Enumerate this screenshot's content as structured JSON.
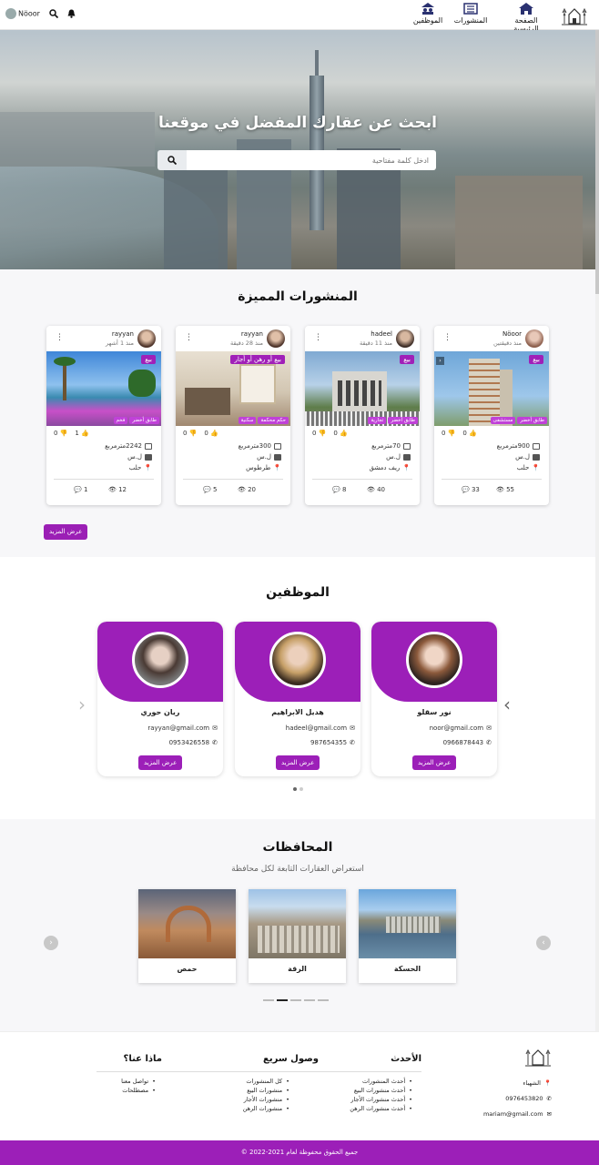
{
  "navbar": {
    "items": [
      {
        "label": "الصفحة الرئيسية",
        "icon": "home-icon"
      },
      {
        "label": "المنشورات",
        "icon": "newspaper-icon"
      },
      {
        "label": "الموظفين",
        "icon": "users-icon"
      }
    ],
    "username": "Nöoor",
    "icons": [
      "bell-icon",
      "search-icon"
    ]
  },
  "hero": {
    "title": "ابحث عن عقارك المفضل في موقعنا",
    "search_placeholder": "ادخل كلمة مفتاحية"
  },
  "featured": {
    "title": "المنشورات المميزة",
    "more_label": "عرض المزيد",
    "posts": [
      {
        "user": "Nöoor",
        "time": "منذ دقيقتين",
        "badge": "بيع",
        "tags": [
          "طابق أخضر",
          "مستشفى"
        ],
        "likes": "0",
        "dislikes": "0",
        "area": "900مترمربع",
        "currency": "ل.س",
        "location": "حلب",
        "comments": "33",
        "views": "55"
      },
      {
        "user": "hadeel",
        "time": "منذ 11 دقيقة",
        "badge": "بيع",
        "tags": [
          "طابق أخضر",
          "تجارية"
        ],
        "likes": "0",
        "dislikes": "0",
        "area": "70مترمربع",
        "currency": "ل.س",
        "location": "ريف دمشق",
        "comments": "8",
        "views": "40"
      },
      {
        "user": "rayyan",
        "time": "منذ 28 دقيقة",
        "badge": "بيع أو رهن أو أجار",
        "tags": [
          "حكم محكمة",
          "سكنية"
        ],
        "likes": "0",
        "dislikes": "0",
        "area": "300مترمربع",
        "currency": "ل.س",
        "location": "طرطوس",
        "comments": "5",
        "views": "20"
      },
      {
        "user": "rayyan",
        "time": "منذ 1 أشهر",
        "badge": "بيع",
        "tags": [
          "طابق أخضر",
          "فخم"
        ],
        "likes": "1",
        "dislikes": "0",
        "area": "2242مترمربع",
        "currency": "ل.س",
        "location": "حلب",
        "comments": "1",
        "views": "12"
      }
    ]
  },
  "employees": {
    "title": "الموظفين",
    "btn_label": "عرض المزيد",
    "items": [
      {
        "name": "نور سقلو",
        "email": "noor@gmail.com",
        "phone": "0966878443"
      },
      {
        "name": "هديل الابراهيم",
        "email": "hadeel@gmail.com",
        "phone": "987654355"
      },
      {
        "name": "ريان حوري",
        "email": "rayyan@gmail.com",
        "phone": "0953426558"
      }
    ]
  },
  "provinces": {
    "title": "المحافظات",
    "subtitle": "استعراض العقارات التابعة لكل محافظة",
    "items": [
      "الحسكة",
      "الرقة",
      "حمص"
    ]
  },
  "footer": {
    "contact": {
      "address": "الشهباء",
      "phone": "0976453820",
      "email": "mariam@gmail.com"
    },
    "latest": {
      "title": "الأحدث",
      "items": [
        "أحدث المنشورات",
        "أحدث منشورات البيع",
        "أحدث منشورات الأجار",
        "أحدث منشورات الرهن"
      ]
    },
    "quick": {
      "title": "وصول سريع",
      "items": [
        "كل المنشورات",
        "منشورات البيع",
        "منشورات الأجار",
        "منشورات الرهن"
      ]
    },
    "about": {
      "title": "ماذا عنا؟",
      "items": [
        "تواصل معنا",
        "مصطلحات"
      ]
    },
    "copyright": "جميع الحقوق محفوظة لعام 2021-2022 ©"
  },
  "colors": {
    "brand": "#9c1fb8",
    "badge": "#a020b8",
    "tag": "#c041d8"
  }
}
